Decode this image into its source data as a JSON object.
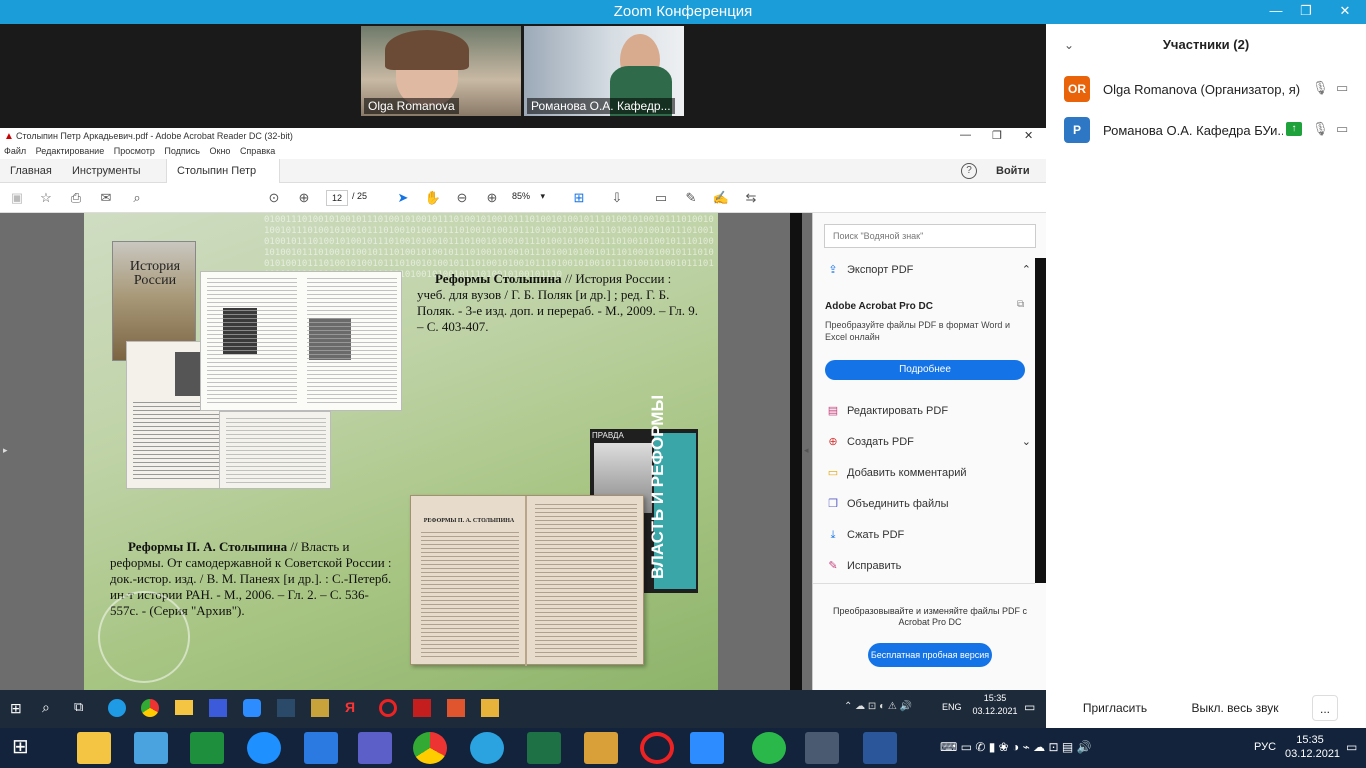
{
  "zoom": {
    "title": "Zoom Конференция",
    "videos": [
      {
        "name": "Olga Romanova"
      },
      {
        "name": "Романова О.А. Кафедр..."
      }
    ],
    "participants_header": "Участники (2)",
    "participants": [
      {
        "initials": "OR",
        "name": "Olga Romanova (Организатор, я)",
        "color": "#e8630a"
      },
      {
        "initials": "Р",
        "name": "Романова О.А. Кафедра БУи...",
        "color": "#2d77c5"
      }
    ],
    "invite_label": "Пригласить",
    "mute_all_label": "Выкл. весь звук",
    "more_label": "..."
  },
  "acrobat": {
    "window_title": "Столыпин Петр Аркадьевич.pdf - Adobe Acrobat Reader DC (32-bit)",
    "menu": [
      "Файл",
      "Редактирование",
      "Просмотр",
      "Подпись",
      "Окно",
      "Справка"
    ],
    "tabs": {
      "home": "Главная",
      "tools": "Инструменты",
      "doc": "Столыпин Петр Ар...",
      "signin": "Войти"
    },
    "page_current": "12",
    "page_total": "/ 25",
    "zoom_level": "85%",
    "search_placeholder": "Поиск \"Водяной знак\"",
    "export_label": "Экспорт PDF",
    "promo_title": "Adobe Acrobat Pro DC",
    "promo_text": "Преобразуйте файлы PDF в формат Word и Excel онлайн",
    "promo_button": "Подробнее",
    "tools": [
      "Редактировать PDF",
      "Создать PDF",
      "Добавить комментарий",
      "Объединить файлы",
      "Сжать PDF",
      "Исправить"
    ],
    "footer_text": "Преобразовывайте и изменяйте файлы PDF с Acrobat Pro DC",
    "footer_button": "Бесплатная пробная версия"
  },
  "slide": {
    "ref1_title": "Реформы Столыпина",
    "ref1_text": " // История России : учеб. для вузов / Г. Б. Поляк [и др.] ; ред. Г. Б. Поляк. - 3-е изд. доп. и перераб. - М., 2009. – Гл. 9. – С. 403-407.",
    "ref2_title": "Реформы П. А. Столыпина",
    "ref2_text": " // Власть и реформы. От самодержавной к Советской России : док.-истор. изд. / В. М. Панеях [и др.]. : С.-Петерб. ин-т истории РАН. - М., 2006. – Гл. 2. – С. 536-557с. - (Серия \"Архив\").",
    "book1_cover": "История России",
    "book2_cover": "ВЛАСТЬ И РЕФОРМЫ",
    "book2_top": "ПРАВДА",
    "book_heading": "РЕФОРМЫ П. А. СТОЛЫПИНА"
  },
  "inner_clock": {
    "time": "15:35",
    "date": "03.12.2021",
    "lang": "ENG"
  },
  "outer_clock": {
    "time": "15:35",
    "date": "03.12.2021",
    "lang": "РУС"
  }
}
